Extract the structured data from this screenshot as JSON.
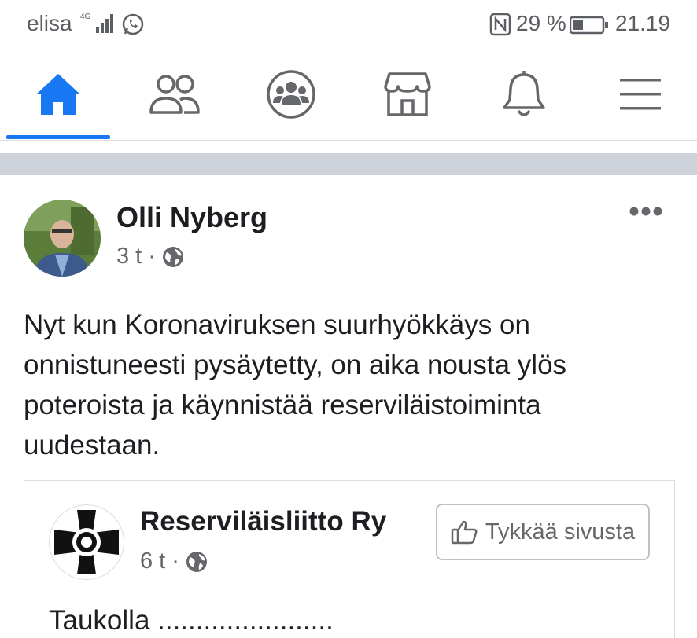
{
  "status_bar": {
    "carrier": "elisa",
    "network": "4G",
    "battery_percent": "29 %",
    "time": "21.19",
    "icons": [
      "signal-icon",
      "whatsapp-icon",
      "nfc-icon",
      "battery-icon"
    ]
  },
  "nav": {
    "tabs": [
      {
        "name": "home",
        "icon": "home-icon",
        "active": true
      },
      {
        "name": "friends",
        "icon": "friends-icon",
        "active": false
      },
      {
        "name": "groups",
        "icon": "groups-icon",
        "active": false
      },
      {
        "name": "marketplace",
        "icon": "marketplace-icon",
        "active": false
      },
      {
        "name": "notifications",
        "icon": "bell-icon",
        "active": false
      },
      {
        "name": "menu",
        "icon": "menu-icon",
        "active": false
      }
    ],
    "accent_color": "#1877f2"
  },
  "post": {
    "author": "Olli Nyberg",
    "time": "3 t",
    "separator": "·",
    "audience_icon": "globe-icon",
    "text": "Nyt kun Koronaviruksen suurhyökkäys on onnistuneesti pysäytetty, on aika nousta ylös poteroista ja käynnistää reserviläistoiminta uudestaan."
  },
  "shared": {
    "page_name": "Reserviläisliitto Ry",
    "time": "6 t",
    "separator": "·",
    "like_button": "Tykkää sivusta",
    "cut_text": "Taukolla ......................."
  }
}
